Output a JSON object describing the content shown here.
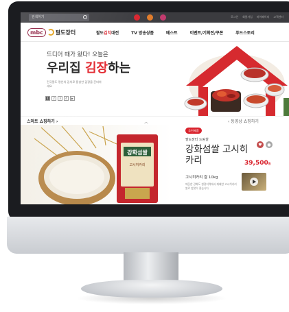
{
  "topbar": {
    "search_placeholder": "검색하기",
    "links": [
      "로그인",
      "회원가입",
      "마이페이지",
      "고객센터"
    ]
  },
  "logo": {
    "mark": "mbc",
    "name": "팔도장터"
  },
  "nav": {
    "items": [
      {
        "label_accent_prefix": "팔도",
        "label_accent": "김치",
        "label_suffix": "대전"
      },
      {
        "label": "TV 방송상품"
      },
      {
        "label": "베스트"
      },
      {
        "label": "이벤트/기획전/쿠폰"
      },
      {
        "label": "푸드스토리"
      }
    ]
  },
  "hero": {
    "subtitle": "드디어 때가 왔다! 오늘은",
    "title_pre": "우리집 ",
    "title_red": "김장",
    "title_post": "하는 날!",
    "description": "전국팔도 명인의 김치로 풍성한 김장을 준비하세요",
    "pages": [
      "1",
      "2",
      "3",
      "4",
      "▶"
    ]
  },
  "smart": {
    "label": "스마트 쇼핑하기 ›",
    "video_label": "‹ 동영상 쇼핑하기"
  },
  "product": {
    "badge": "추천제품",
    "brand": "팔도장터 드림쌀",
    "name": "강화섬쌀 고시히카리",
    "price": "39,500",
    "price_unit": "원",
    "spec": "고시히카리 쌀 10kg",
    "description": "깨끗한 강화도 청정지역에서 재배한 고시히카리 쌀로 밥맛이 좋습니다",
    "bag_title": "강화섬쌀",
    "bag_sub": "고시히카리"
  },
  "colors": {
    "accent": "#d9232d",
    "brand": "#8a1538",
    "bezel": "#1b1c20"
  }
}
